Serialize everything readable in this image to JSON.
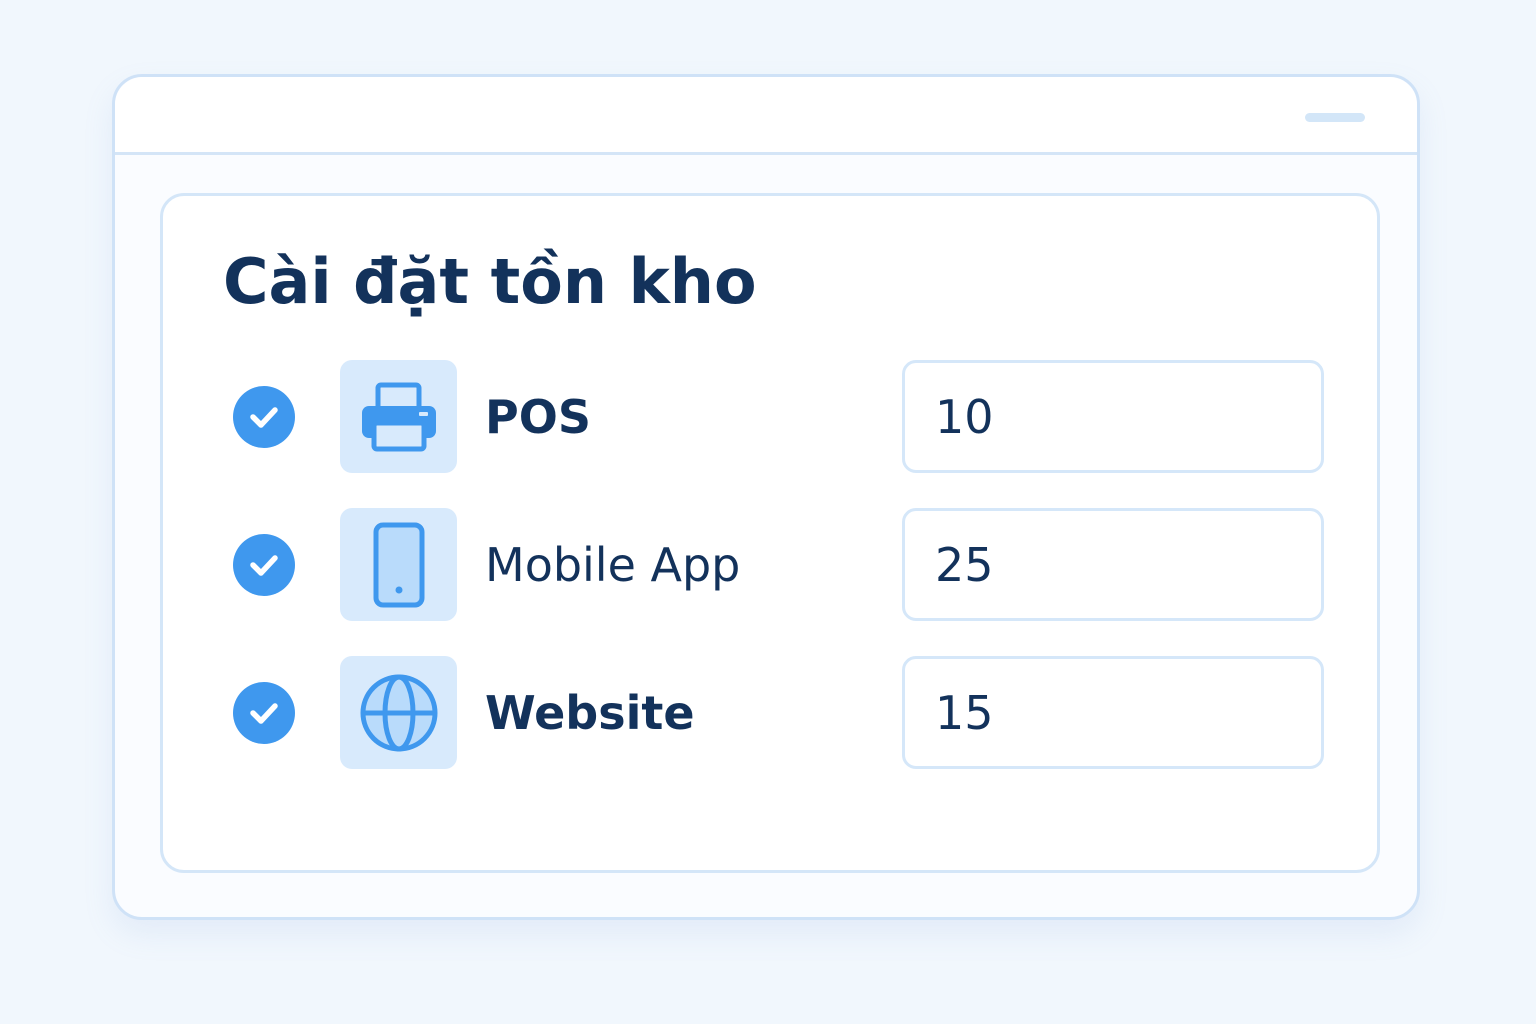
{
  "colors": {
    "background": "#f1f7fd",
    "accent": "#3f98ee",
    "tile_background": "#d8eafc",
    "text_primary": "#13325b",
    "border": "#d4e6f8"
  },
  "panel": {
    "title": "Cài đặt tồn kho"
  },
  "channels": [
    {
      "icon": "printer-icon",
      "label": "POS",
      "checked": true,
      "quantity": "10"
    },
    {
      "icon": "mobile-phone-icon",
      "label": "Mobile App",
      "checked": true,
      "quantity": "25"
    },
    {
      "icon": "globe-icon",
      "label": "Website",
      "checked": true,
      "quantity": "15"
    }
  ]
}
